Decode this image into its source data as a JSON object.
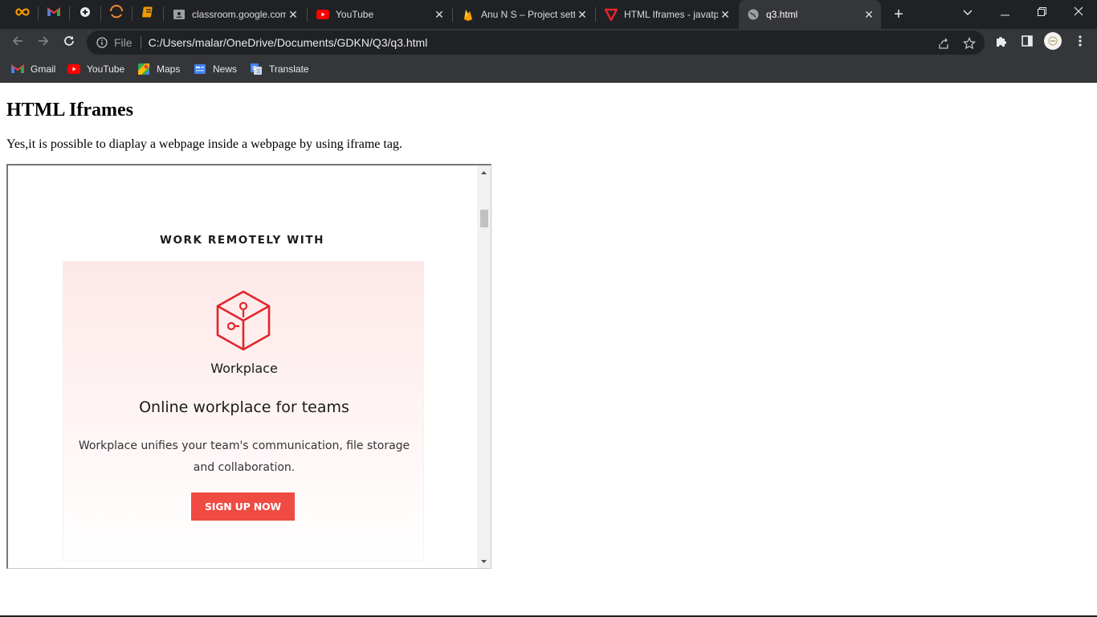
{
  "browser": {
    "tabs": [
      {
        "title": "classroom.google.com",
        "favicon": "classroom-icon"
      },
      {
        "title": "YouTube",
        "favicon": "youtube-icon"
      },
      {
        "title": "Anu N S – Project settings",
        "favicon": "firebase-icon"
      },
      {
        "title": "HTML Iframes - javatpoint",
        "favicon": "javatpoint-icon"
      },
      {
        "title": "q3.html",
        "favicon": "globe-icon",
        "active": true
      }
    ],
    "pinned_tabs": [
      "infinity-icon",
      "gmail-icon",
      "puzzle-icon",
      "loader-icon",
      "notebook-icon"
    ],
    "new_tab_symbol": "+",
    "address": {
      "scheme_label": "File",
      "url": "C:/Users/malar/OneDrive/Documents/GDKN/Q3/q3.html"
    },
    "bookmarks": [
      {
        "label": "Gmail",
        "icon": "gmail-icon"
      },
      {
        "label": "YouTube",
        "icon": "youtube-icon"
      },
      {
        "label": "Maps",
        "icon": "maps-icon"
      },
      {
        "label": "News",
        "icon": "news-icon"
      },
      {
        "label": "Translate",
        "icon": "translate-icon"
      }
    ]
  },
  "page": {
    "heading": "HTML Iframes",
    "description": "Yes,it is possible to diaplay a webpage inside a webpage by using iframe tag."
  },
  "iframe": {
    "ad_heading": "WORK REMOTELY WITH",
    "brand": "Workplace",
    "title": "Online workplace for teams",
    "body_line1": "Workplace unifies your team's communication, file storage",
    "body_line2": "and collaboration.",
    "cta": "SIGN UP NOW"
  },
  "colors": {
    "tab_bar": "#202124",
    "toolbar": "#35363a",
    "cta": "#ef4b42",
    "logo_red": "#e0262c"
  }
}
